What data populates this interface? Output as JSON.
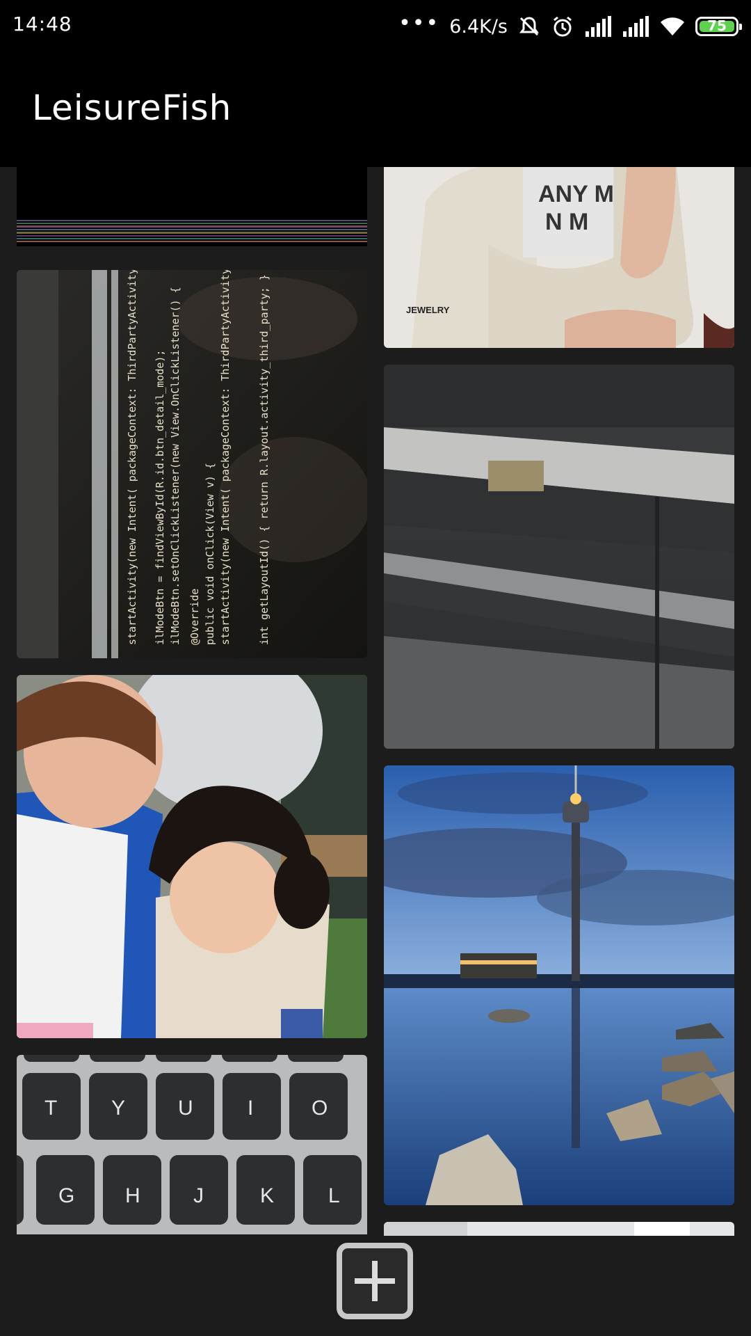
{
  "status_bar": {
    "time": "14:48",
    "more": "•••",
    "network_speed": "6.4K/s",
    "icons": [
      "mute-icon",
      "alarm-icon",
      "signal-icon",
      "signal-icon",
      "wifi-icon"
    ],
    "battery_level": "75",
    "battery_color": "#5ed14f"
  },
  "app_bar": {
    "title": "LeisureFish"
  },
  "gallery": {
    "photos": [
      {
        "name": "glitched-dark-photo"
      },
      {
        "name": "jewelry-magazine-photo",
        "caption": "JEWELRY"
      },
      {
        "name": "code-screen-photo"
      },
      {
        "name": "metal-rack-photo"
      },
      {
        "name": "man-and-child-photo"
      },
      {
        "name": "macau-tower-photo"
      },
      {
        "name": "keyboard-photo",
        "keys_top": [
          "T",
          "Y",
          "U",
          "I",
          "O"
        ],
        "keys_bottom": [
          "G",
          "H",
          "J",
          "K",
          "L"
        ]
      },
      {
        "name": "partial-photo"
      }
    ]
  },
  "bottom_bar": {
    "add_icon": "plus-square-icon"
  }
}
